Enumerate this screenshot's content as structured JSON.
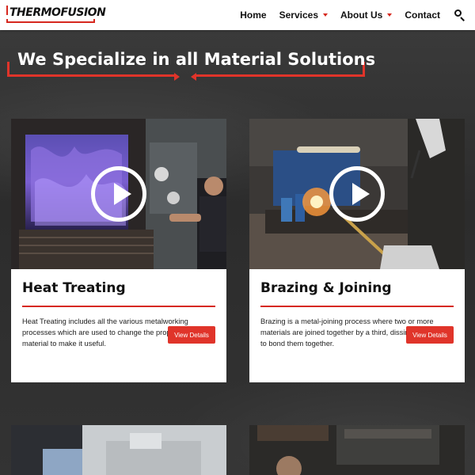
{
  "header": {
    "logo_text": "THERMOFUSION",
    "nav": [
      {
        "label": "Home",
        "has_dropdown": false
      },
      {
        "label": "Services",
        "has_dropdown": true
      },
      {
        "label": "About Us",
        "has_dropdown": true
      },
      {
        "label": "Contact",
        "has_dropdown": false
      }
    ],
    "search_icon": "search-icon"
  },
  "hero": {
    "title": "We Specialize in all Material Solutions"
  },
  "cards": [
    {
      "title": "Heat Treating",
      "description": "Heat Treating includes all the various metalworking processes which are used to change the properties of a material to make it useful.",
      "button": "View Details",
      "media_icon": "play-icon"
    },
    {
      "title": "Brazing & Joining",
      "description": "Brazing is a metal-joining process where two or more materials are joined together by a third, dissimilar material to bond them together.",
      "button": "View Details",
      "media_icon": "play-icon"
    }
  ],
  "colors": {
    "accent": "#e0342a",
    "header_bg": "#ffffff",
    "page_bg": "#2b2b2b"
  }
}
